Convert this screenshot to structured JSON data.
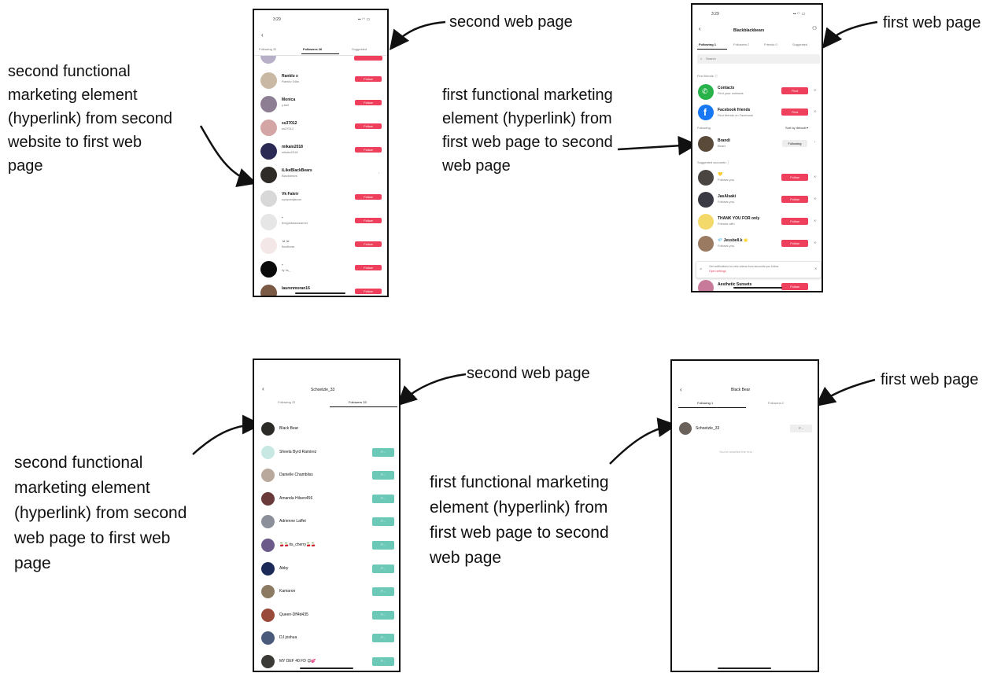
{
  "annotations": {
    "top_second_page": "second web page",
    "top_first_page": "first web page",
    "top_left_lines": [
      "second functional",
      "marketing element",
      "(hyperlink) from second",
      "website to first web",
      "page"
    ],
    "top_mid_lines": [
      "first functional marketing",
      "element (hyperlink) from",
      "first web page to second",
      "web page"
    ],
    "bottom_second_page": "second web page",
    "bottom_first_page": "first web page",
    "bottom_left_lines": [
      "second functional",
      "marketing element",
      "(hyperlink) from second",
      "web page to first web",
      "page"
    ],
    "bottom_mid_lines": [
      "first functional marketing",
      "element (hyperlink) from",
      "first web page to second",
      "web page"
    ]
  },
  "phone_a": {
    "time": "3:29",
    "tabs": [
      "Following 33",
      "Followers 26",
      "Suggested"
    ],
    "follow_label": "Follow",
    "rows": [
      {
        "name": "Ranklo x",
        "sub": "Ranklo 04ks",
        "follow": true,
        "color": "#c9b8a4"
      },
      {
        "name": "Monica",
        "sub": "y.bell",
        "follow": true,
        "color": "#8e7e93"
      },
      {
        "name": "ss37012",
        "sub": "ss37012",
        "follow": true,
        "color": "#d4a5a5"
      },
      {
        "name": "mikaio2018",
        "sub": "mikaio2018",
        "follow": true,
        "color": "#2b2a55"
      },
      {
        "name": "iLikeBlackBears",
        "sub": "Blackbears",
        "follow": false,
        "color": "#2f2b26"
      },
      {
        "name": "Vk Fakrir",
        "sub": "uyxyoedjisvon",
        "follow": true,
        "color": "#d8d8d8"
      },
      {
        "name": "-",
        "sub": "thegoldstarseamer",
        "follow": true,
        "color": "#e6e6e6"
      },
      {
        "name": "☺☺",
        "sub": "flowflows",
        "follow": true,
        "color": "#f3e7e7"
      },
      {
        "name": "-",
        "sub": "ily its_",
        "follow": true,
        "color": "#0a0a0a"
      },
      {
        "name": "laurenmoran16",
        "sub": "",
        "follow": true,
        "color": "#7a5a45"
      }
    ]
  },
  "phone_b": {
    "time": "3:29",
    "title": "Blackblackbears",
    "tabs": [
      "Following 1",
      "Followers 0",
      "Friends 0",
      "Suggested"
    ],
    "search_placeholder": "Search",
    "section_find": "Find friends ⓘ",
    "contacts_name": "Contacts",
    "contacts_sub": "Find your contacts",
    "facebook_name": "Facebook friends",
    "facebook_sub": "Find friends on Facebook",
    "find_label": "Find",
    "section_following": "Following",
    "sort_label": "Sort by default ▾",
    "following_name": "Brandi",
    "following_sub": "Bears",
    "following_button": "Following",
    "section_suggested": "Suggested accounts ⓘ",
    "follow_label": "Follow",
    "suggested": [
      {
        "name": "💛",
        "sub": "Follows you",
        "color": "#4a4540"
      },
      {
        "name": "JasAlsaki",
        "sub": "Follows you",
        "color": "#3a3a44"
      },
      {
        "name": "THANK YOU FOR only",
        "sub": "Friends with",
        "color": "#f3d96a"
      },
      {
        "name": "💎 Jessbell.k 🌟",
        "sub": "Follows you",
        "color": "#9a7a60"
      }
    ],
    "notice_text": "Get notifications for new videos from accounts you follow.",
    "notice_link": "Open settings",
    "last_name": "Aesthetic Sunsets"
  },
  "phone_c": {
    "title": "Schoetzle_33",
    "tabs": [
      "Following 33",
      "Followers 33"
    ],
    "follow_label": "F...",
    "rows": [
      {
        "name": "Black Bear",
        "color": "#2d2b28",
        "button": false
      },
      {
        "name": "Sheela Byrd Ramirez",
        "color": "#c8e8e3",
        "button": true
      },
      {
        "name": "Danielle Chambliss",
        "color": "#b9a99c",
        "button": true
      },
      {
        "name": "Amanda Hilsen456",
        "color": "#6a3a3a",
        "button": true
      },
      {
        "name": "Adrienne Laffet",
        "color": "#8a8f99",
        "button": true
      },
      {
        "name": "🍒🍒its_cherry🍒🍒",
        "color": "#6b5a8a",
        "button": true
      },
      {
        "name": "Abby",
        "color": "#1c2a5a",
        "button": true
      },
      {
        "name": "Kamaron",
        "color": "#8d7a63",
        "button": true
      },
      {
        "name": "Queen-Dff4d435",
        "color": "#9a4a3a",
        "button": true
      },
      {
        "name": "DJ joshua",
        "color": "#4a5a7a",
        "button": true
      },
      {
        "name": "MY DEF 40 FD 😊💕",
        "color": "#3c3a36",
        "button": true
      }
    ]
  },
  "phone_d": {
    "title": "Black Bear",
    "tabs": [
      "Following 1",
      "Followers 0"
    ],
    "row_name": "Schoetzle_33",
    "row_button": "F...",
    "end_text": "You've reached the end"
  }
}
